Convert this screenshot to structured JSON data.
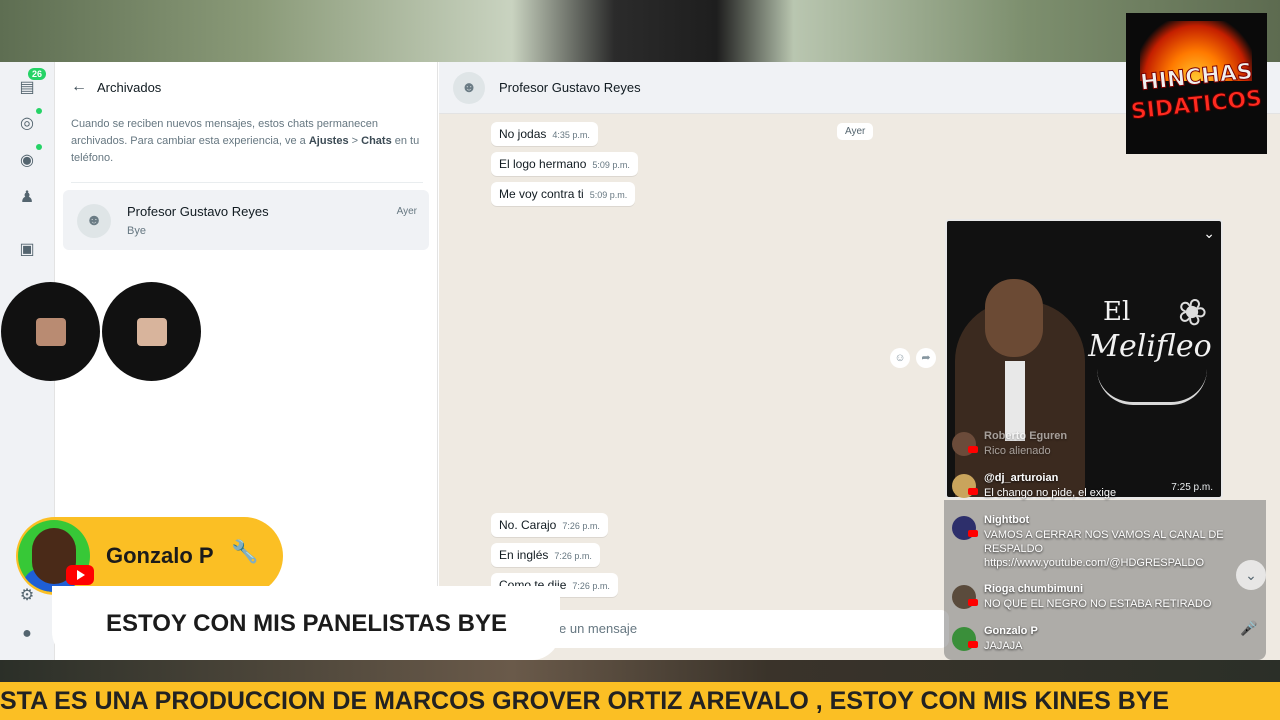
{
  "sidebar_rail": {
    "badge_count": "26"
  },
  "archived": {
    "title": "Archivados",
    "info_prefix": "Cuando se reciben nuevos mensajes, estos chats permanecen archivados. Para cambiar esta experiencia, ve a ",
    "info_link1": "Ajustes",
    "info_sep": " > ",
    "info_link2": "Chats",
    "info_suffix": " en tu teléfono.",
    "chat": {
      "name": "Profesor Gustavo Reyes",
      "last_message": "Bye",
      "time": "Ayer"
    }
  },
  "conversation": {
    "contact_name": "Profesor Gustavo Reyes",
    "day_label": "Ayer",
    "messages_top": [
      {
        "text": "No jodas",
        "time": "4:35 p.m."
      },
      {
        "text": "El logo hermano",
        "time": "5:09 p.m."
      },
      {
        "text": "Me voy contra ti",
        "time": "5:09 p.m."
      }
    ],
    "messages_bottom": [
      {
        "text": "No. Carajo",
        "time": "7:26 p.m."
      },
      {
        "text": "En inglés",
        "time": "7:26 p.m."
      },
      {
        "text": "Como te dije",
        "time": "7:26 p.m."
      }
    ],
    "composer_placeholder": "e un mensaje",
    "video_time": "7:25 p.m.",
    "video_brand_el": "El",
    "video_brand": "Melifleo"
  },
  "stream_chat": [
    {
      "name": "Roberto Eguren",
      "text": "Rico alienado",
      "avatar_color": "#6b4b3a"
    },
    {
      "name": "@dj_arturoian",
      "text": "El chango no pide, el exige",
      "avatar_color": "#c9a45c"
    },
    {
      "name": "Nightbot",
      "text": "VAMOS A CERRAR NOS VAMOS AL CANAL DE RESPALDO https://www.youtube.com/@HDGRESPALDO",
      "avatar_color": "#2d2f6b"
    },
    {
      "name": "Rioga chumbimuni",
      "text": "NO QUE EL NEGRO NO ESTABA RETIRADO",
      "avatar_color": "#5a4b3c"
    },
    {
      "name": "Gonzalo P",
      "text": "JAJAJA",
      "avatar_color": "#3a8f3a"
    }
  ],
  "logo": {
    "line1": "HINCHAS",
    "line2": "SIDATICOS"
  },
  "host": {
    "name": "Gonzalo P",
    "message": "ESTOY CON MIS PANELISTAS BYE"
  },
  "ticker": {
    "text": "STA ES UNA PRODUCCION DE MARCOS GROVER ORTIZ AREVALO , ESTOY CON MIS KINES BYE"
  },
  "colors": {
    "accent": "#fbbf24",
    "whatsapp_green": "#25d366",
    "youtube_red": "#ff0000"
  }
}
